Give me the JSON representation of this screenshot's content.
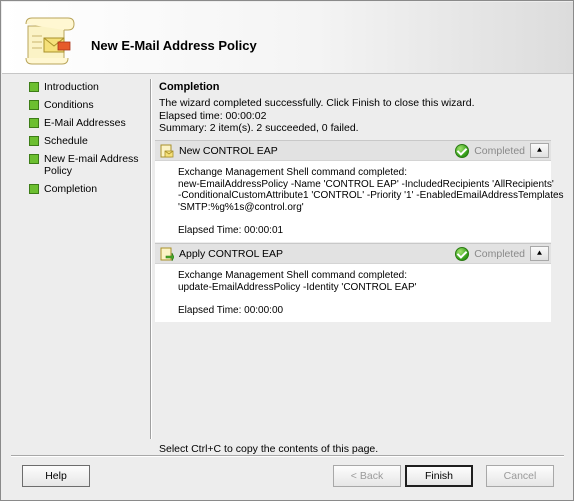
{
  "header": {
    "title": "New E-Mail Address Policy",
    "icon": "scroll-wizard-icon"
  },
  "nav": {
    "items": [
      {
        "label": "Introduction"
      },
      {
        "label": "Conditions"
      },
      {
        "label": "E-Mail Addresses"
      },
      {
        "label": "Schedule"
      },
      {
        "label": "New E-mail Address Policy"
      },
      {
        "label": "Completion"
      }
    ]
  },
  "main": {
    "title": "Completion",
    "message": "The wizard completed successfully. Click Finish to close this wizard.",
    "elapsed": "Elapsed time: 00:00:02",
    "summary": "Summary: 2 item(s). 2 succeeded, 0 failed."
  },
  "steps": [
    {
      "title": "New CONTROL EAP",
      "status": "Completed",
      "lines": [
        "Exchange Management Shell command completed:",
        "new-EmailAddressPolicy -Name 'CONTROL EAP' -IncludedRecipients 'AllRecipients'",
        "-ConditionalCustomAttribute1 'CONTROL' -Priority '1' -EnabledEmailAddressTemplates",
        "'SMTP:%g%1s@control.org'"
      ],
      "elapsed": "Elapsed Time: 00:00:01"
    },
    {
      "title": "Apply CONTROL EAP",
      "status": "Completed",
      "lines": [
        "Exchange Management Shell command completed:",
        "update-EmailAddressPolicy -Identity 'CONTROL EAP'"
      ],
      "elapsed": "Elapsed Time: 00:00:00"
    }
  ],
  "hint": "Select Ctrl+C to copy the contents of this page.",
  "buttons": {
    "help": "Help",
    "back": "< Back",
    "finish": "Finish",
    "cancel": "Cancel"
  }
}
